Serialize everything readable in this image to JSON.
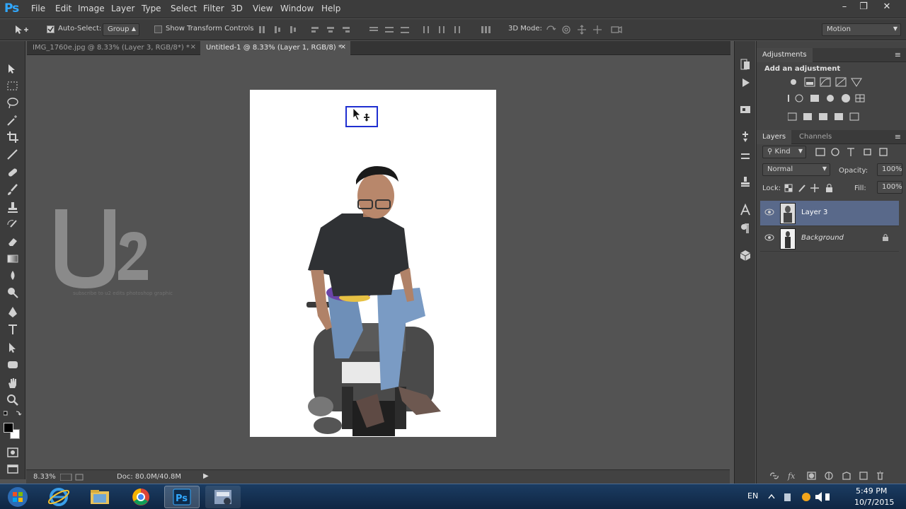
{
  "app": {
    "logo": "Ps",
    "menu": [
      "File",
      "Edit",
      "Image",
      "Layer",
      "Type",
      "Select",
      "Filter",
      "3D",
      "View",
      "Window",
      "Help"
    ]
  },
  "options_bar": {
    "auto_select_label": "Auto-Select:",
    "group_value": "Group",
    "transform_controls_label": "Show Transform Controls",
    "mode_3d_label": "3D Mode:",
    "workspace_value": "Motion"
  },
  "tabs": [
    {
      "label": "IMG_1760e.jpg @ 8.33% (Layer 3, RGB/8*) *",
      "active": false
    },
    {
      "label": "Untitled-1 @ 8.33% (Layer 1, RGB/8) *",
      "active": true
    }
  ],
  "watermark": {
    "logo_text": "U2",
    "caption": "subscribe to u2 edits photoshop graphic"
  },
  "statusbar": {
    "zoom": "8.33%",
    "doc_info": "Doc: 80.0M/40.8M"
  },
  "adjustments_panel": {
    "tab_label": "Adjustments",
    "header": "Add an adjustment"
  },
  "layers_panel": {
    "tabs": [
      "Layers",
      "Channels"
    ],
    "kind_filter": "Kind",
    "blend_mode": "Normal",
    "opacity_label": "Opacity:",
    "opacity_value": "100%",
    "lock_label": "Lock:",
    "fill_label": "Fill:",
    "fill_value": "100%",
    "layers": [
      {
        "name": "Layer 3",
        "selected": true,
        "visible": true
      },
      {
        "name": "Background",
        "selected": false,
        "visible": true,
        "locked": true
      }
    ]
  },
  "taskbar": {
    "language": "EN",
    "time": "5:49 PM",
    "date": "10/7/2015"
  },
  "colors": {
    "accent": "#31a8ff",
    "selection_box": "#1f2fd0",
    "selected_layer": "#59698a"
  }
}
